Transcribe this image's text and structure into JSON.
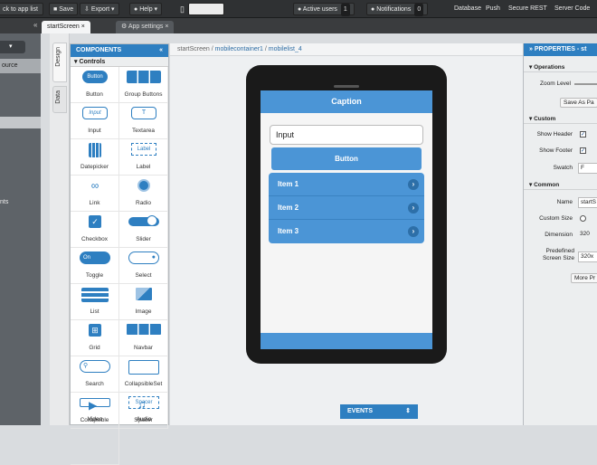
{
  "topbar": {
    "back_label": "ck to app list",
    "save_label": "Save",
    "export_label": "Export",
    "help_label": "Help",
    "active_users_label": "Active users",
    "active_users_count": "1",
    "notifications_label": "Notifications",
    "notifications_count": "0",
    "links": [
      "Database",
      "Push",
      "Secure REST",
      "Server Code"
    ]
  },
  "tabs": [
    {
      "label": "startScreen"
    },
    {
      "label": "App settings"
    }
  ],
  "left_panel": {
    "item": "ource",
    "label2": "nts"
  },
  "side_tabs": [
    "Design",
    "Data"
  ],
  "components": {
    "title": "COMPONENTS",
    "section": "Controls",
    "items": [
      {
        "label": "Button",
        "icon": "button-widget-icon"
      },
      {
        "label": "Group Buttons",
        "icon": "group-buttons-icon"
      },
      {
        "label": "Input",
        "icon": "input-icon"
      },
      {
        "label": "Textarea",
        "icon": "textarea-icon"
      },
      {
        "label": "Datepicker",
        "icon": "calendar-icon"
      },
      {
        "label": "Label",
        "icon": "label-icon"
      },
      {
        "label": "Link",
        "icon": "link-icon"
      },
      {
        "label": "Radio",
        "icon": "radio-icon"
      },
      {
        "label": "Checkbox",
        "icon": "checkbox-icon"
      },
      {
        "label": "Slider",
        "icon": "slider-icon"
      },
      {
        "label": "Toggle",
        "icon": "toggle-icon"
      },
      {
        "label": "Select",
        "icon": "select-icon"
      },
      {
        "label": "List",
        "icon": "list-icon"
      },
      {
        "label": "Image",
        "icon": "image-icon"
      },
      {
        "label": "Grid",
        "icon": "grid-icon"
      },
      {
        "label": "Navbar",
        "icon": "navbar-icon"
      },
      {
        "label": "Search",
        "icon": "search-icon"
      },
      {
        "label": "CollapsibleSet",
        "icon": "collapsible-set-icon"
      },
      {
        "label": "Collapsible",
        "icon": "collapsible-icon"
      },
      {
        "label": "Spacer",
        "icon": "spacer-icon"
      },
      {
        "label": "Video",
        "icon": "video-icon"
      },
      {
        "label": "Audio",
        "icon": "audio-icon"
      }
    ],
    "icon_texts": {
      "button": "Button",
      "input": "Input",
      "textarea": "T",
      "label": "Label",
      "toggle": "On",
      "spacer": "Spacer"
    }
  },
  "breadcrumb": {
    "items": [
      "startScreen",
      "mobilecontainer1",
      "mobilelist_4"
    ]
  },
  "phone": {
    "caption": "Caption",
    "input_value": "Input",
    "button_label": "Button",
    "list_items": [
      "Item 1",
      "Item 2",
      "Item 3"
    ]
  },
  "events_label": "EVENTS",
  "properties": {
    "title": "PROPERTIES - st",
    "operations_label": "Operations",
    "zoom_level_label": "Zoom Level",
    "save_as_page_label": "Save As Pa",
    "custom_label": "Custom",
    "show_header_label": "Show Header",
    "show_header_checked": true,
    "show_footer_label": "Show Footer",
    "show_footer_checked": true,
    "swatch_label": "Swatch",
    "swatch_value": "F",
    "common_label": "Common",
    "name_label": "Name",
    "name_value": "startS",
    "custom_size_label": "Custom Size",
    "dimension_label": "Dimension",
    "dimension_value": "320",
    "predefined_label": "Predefined Screen Size",
    "predefined_value": "320x",
    "more_label": "More Pr"
  },
  "colors": {
    "accent": "#2e7fc1",
    "phone_blue": "#4b95d6",
    "topbar": "#2f3133"
  }
}
